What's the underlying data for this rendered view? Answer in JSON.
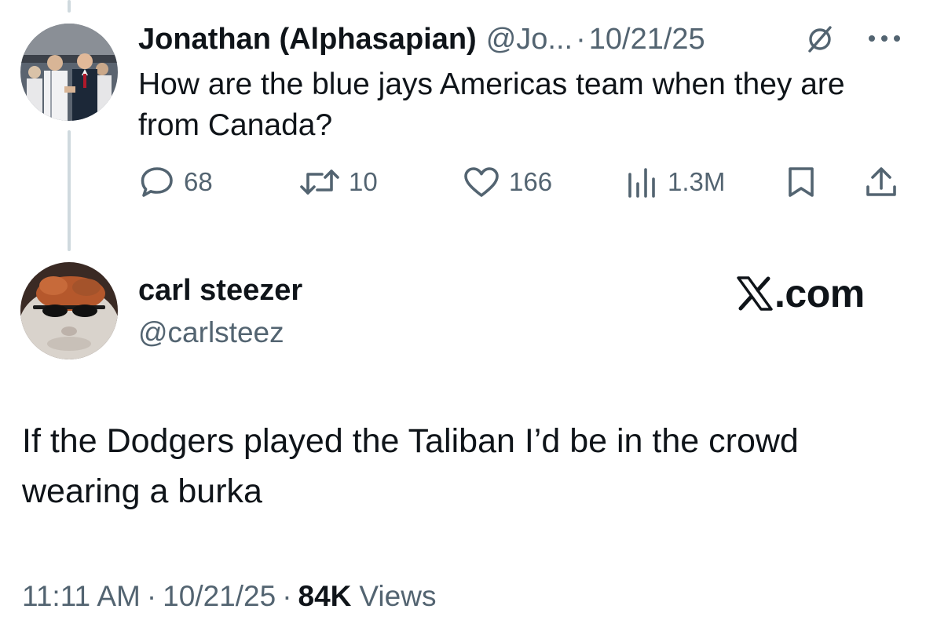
{
  "parent_tweet": {
    "author_name": "Jonathan (Alphasapian)",
    "handle": "@Jo...",
    "separator": "·",
    "date": "10/21/25",
    "text": "How are the blue jays Americas team when they are from Canada?",
    "header_icons": [
      "grok-icon",
      "more-icon"
    ],
    "actions": {
      "replies": "68",
      "retweets": "10",
      "likes": "166",
      "views": "1.3M"
    }
  },
  "main_tweet": {
    "author_name": "carl steezer",
    "handle": "@carlsteez",
    "watermark": ".com",
    "text": "If the Dodgers played the Taliban I’d be in the crowd wearing a burka",
    "time": "11:11 AM",
    "separator": "·",
    "date": "10/21/25",
    "views_count": "84K",
    "views_label": "Views"
  },
  "colors": {
    "text_primary": "#0f1419",
    "text_secondary": "#536471",
    "thread_line": "#cfd9de",
    "background": "#ffffff"
  }
}
